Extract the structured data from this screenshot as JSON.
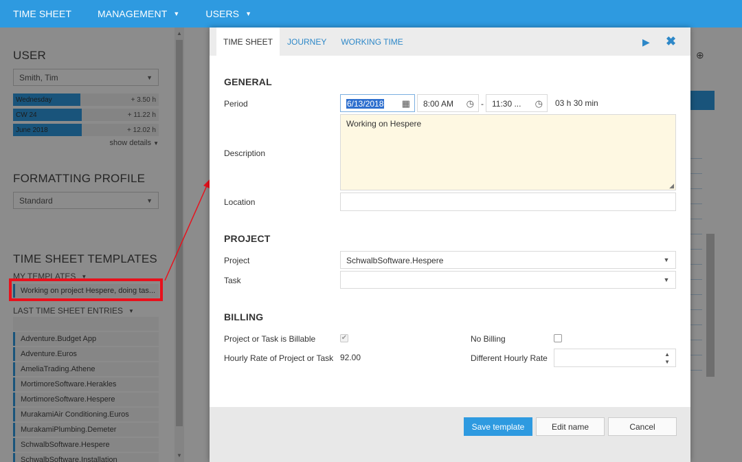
{
  "topbar": {
    "items": [
      {
        "label": "TIME SHEET",
        "has_caret": false
      },
      {
        "label": "MANAGEMENT",
        "has_caret": true
      },
      {
        "label": "USERS",
        "has_caret": true
      }
    ],
    "background": "#2e9ae0"
  },
  "sidebar": {
    "user_title": "USER",
    "user_value": "Smith, Tim",
    "stats": [
      {
        "label": "Wednesday",
        "value": "+ 3.50 h",
        "fill_percent": 46
      },
      {
        "label": "CW 24",
        "value": "+ 11.22 h",
        "fill_percent": 47
      },
      {
        "label": "June 2018",
        "value": "+ 12.02 h",
        "fill_percent": 47
      }
    ],
    "show_details": "show details",
    "formatting_title": "FORMATTING PROFILE",
    "formatting_value": "Standard",
    "templates_title": "TIME SHEET TEMPLATES",
    "my_templates_label": "MY TEMPLATES",
    "my_templates": [
      "Working on project Hespere, doing tas..."
    ],
    "last_entries_label": "LAST TIME SHEET ENTRIES",
    "last_entries": [
      "",
      "Adventure.Budget App",
      "Adventure.Euros",
      "AmeliaTrading.Athene",
      "MortimoreSoftware.Herakles",
      "MortimoreSoftware.Hespere",
      "MurakamiAir Conditioning.Euros",
      "MurakamiPlumbing.Demeter",
      "SchwalbSoftware.Hespere",
      "SchwalbSoftware.Installation"
    ]
  },
  "dialog": {
    "tabs": [
      "TIME SHEET",
      "JOURNEY",
      "WORKING TIME"
    ],
    "active_tab": "TIME SHEET",
    "icons": {
      "play": "play-icon",
      "close": "close-icon"
    },
    "general": {
      "title": "GENERAL",
      "period_label": "Period",
      "date": "6/13/2018",
      "start_time": "8:00 AM",
      "dash": "-",
      "end_time": "11:30 ...",
      "duration": "03 h 30 min",
      "description_label": "Description",
      "description": "Working on Hespere",
      "location_label": "Location",
      "location": ""
    },
    "project": {
      "title": "PROJECT",
      "project_label": "Project",
      "project_value": "SchwalbSoftware.Hespere",
      "task_label": "Task",
      "task_value": ""
    },
    "billing": {
      "title": "BILLING",
      "billable_label": "Project or Task is Billable",
      "billable_checked": true,
      "no_billing_label": "No Billing",
      "no_billing_checked": false,
      "hourly_rate_label": "Hourly Rate of Project or Task",
      "hourly_rate_value": "92.00",
      "diff_rate_label": "Different Hourly Rate",
      "diff_rate_value": ""
    },
    "buttons": {
      "save": "Save template",
      "edit": "Edit name",
      "cancel": "Cancel"
    }
  },
  "colors": {
    "accent": "#2e9ae0",
    "highlight": "#e8111c",
    "description_bg": "#fef8e2"
  }
}
